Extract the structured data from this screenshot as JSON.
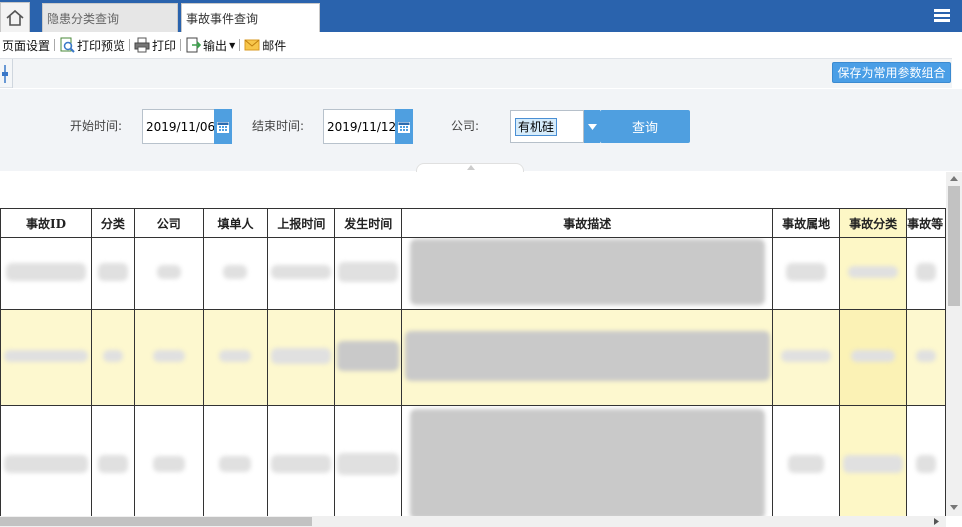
{
  "tabs": [
    {
      "label": "隐患分类查询"
    },
    {
      "label": "事故事件查询"
    }
  ],
  "toolbar": {
    "page_setup": "页面设置",
    "print_preview": "打印预览",
    "print": "打印",
    "export": "输出",
    "mail": "邮件"
  },
  "subbar": {
    "save_label": "保存为常用参数组合"
  },
  "filter": {
    "start_label": "开始时间:",
    "start_value": "2019/11/06",
    "end_label": "结束时间:",
    "end_value": "2019/11/12",
    "company_label": "公司:",
    "company_value": "有机硅",
    "query_label": "查询"
  },
  "grid": {
    "columns": [
      "事故ID",
      "分类",
      "公司",
      "填单人",
      "上报时间",
      "发生时间",
      "事故描述",
      "事故属地",
      "事故分类",
      "事故等"
    ]
  },
  "colors": {
    "tab_bar": "#2a63ad",
    "accent_button": "#4f9fe0",
    "row_highlight": "#fdf8cf"
  }
}
